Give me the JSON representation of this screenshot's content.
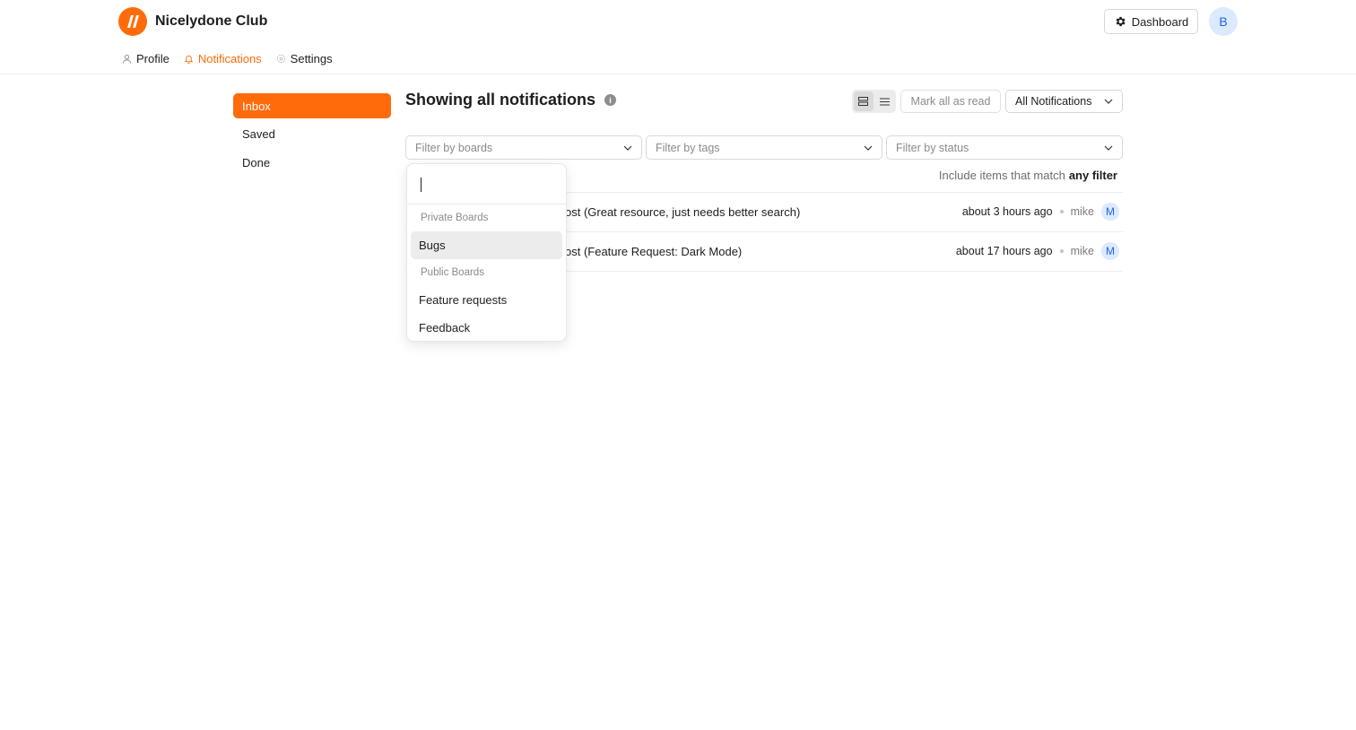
{
  "app": {
    "name": "Nicelydone Club",
    "brand_color": "#ff6b0a"
  },
  "header": {
    "dashboard_label": "Dashboard",
    "avatar_initial": "B"
  },
  "nav": {
    "profile": "Profile",
    "notifications": "Notifications",
    "settings": "Settings",
    "active": "notifications"
  },
  "sidebar": {
    "items": [
      {
        "label": "Inbox",
        "active": true
      },
      {
        "label": "Saved"
      },
      {
        "label": "Done"
      }
    ]
  },
  "main": {
    "title": "Showing all notifications",
    "mark_all_read": "Mark all as read",
    "all_notifications": "All Notifications",
    "filters": {
      "boards": "Filter by boards",
      "tags": "Filter by tags",
      "status": "Filter by status"
    },
    "include_prefix": "Include items that match",
    "include_mode": "any filter",
    "notifications": [
      {
        "text": "ost (Great resource, just needs better search)",
        "time": "about 3 hours ago",
        "user": "mike",
        "avatar": "M"
      },
      {
        "text": "ost (Feature Request: Dark Mode)",
        "time": "about 17 hours ago",
        "user": "mike",
        "avatar": "M"
      }
    ]
  },
  "dropdown": {
    "search_value": "",
    "groups": [
      {
        "label": "Private Boards",
        "items": [
          "Bugs"
        ]
      },
      {
        "label": "Public Boards",
        "items": [
          "Feature requests",
          "Feedback"
        ]
      }
    ],
    "highlighted": "Bugs"
  },
  "icons": {
    "logo": "logo-mark",
    "dashboard": "gear-icon",
    "profile": "user-icon",
    "notifications": "bell-icon",
    "settings": "gear-icon",
    "info": "info-icon",
    "view_cards": "cards-view-icon",
    "view_list": "list-view-icon",
    "chevron": "chevron-down-icon"
  }
}
